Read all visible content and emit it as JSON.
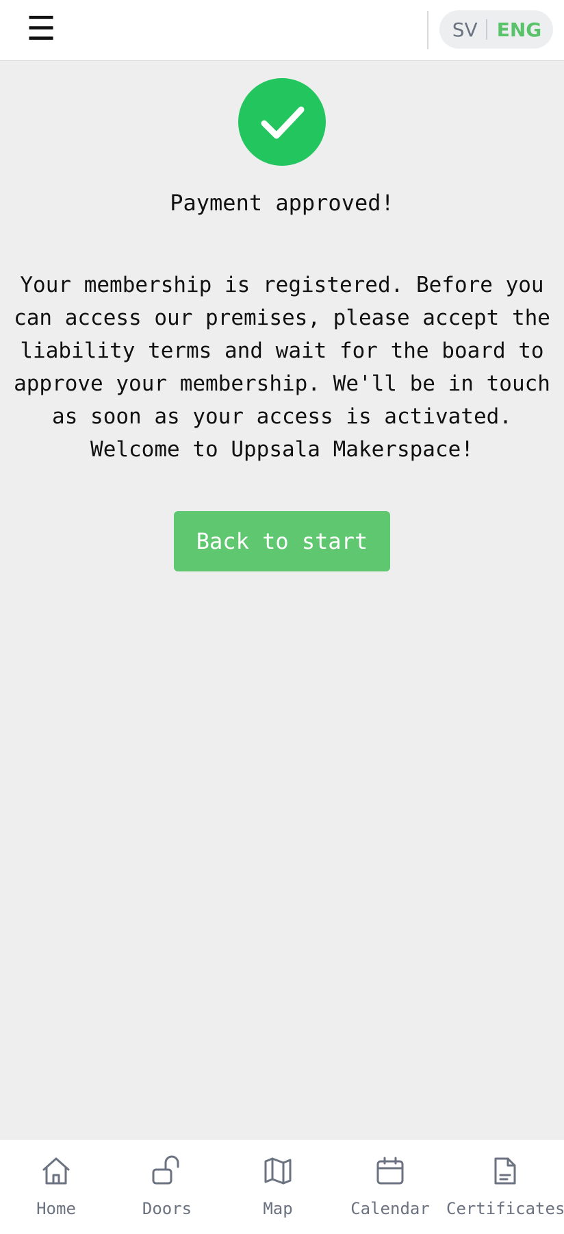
{
  "header": {
    "menu_icon": "hamburger-menu-icon",
    "menu_glyph": "☰",
    "language": {
      "sv_label": "SV",
      "eng_label": "ENG",
      "active": "ENG",
      "active_color": "#5ac26b"
    }
  },
  "main": {
    "status_icon": "check-circle-icon",
    "status_color": "#22c55e",
    "title": "Payment approved!",
    "message": "Your membership is registered. Before you can access our premises, please accept the liability terms and wait for the board to approve your membership. We'll be in touch as soon as your access is activated. Welcome to Uppsala Makerspace!",
    "back_button_label": "Back to start",
    "back_button_color": "#5fc76f"
  },
  "bottom_nav": {
    "items": [
      {
        "label": "Home",
        "icon": "home-icon"
      },
      {
        "label": "Doors",
        "icon": "unlocked-padlock-icon"
      },
      {
        "label": "Map",
        "icon": "map-icon"
      },
      {
        "label": "Calendar",
        "icon": "calendar-icon"
      },
      {
        "label": "Certificates",
        "icon": "document-icon"
      }
    ]
  }
}
